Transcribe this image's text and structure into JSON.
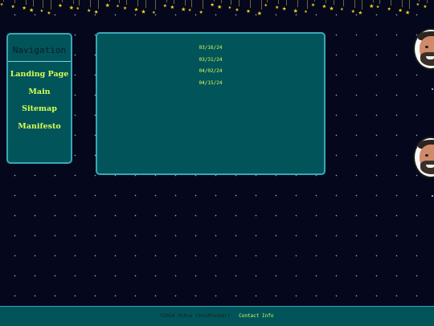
{
  "nav": {
    "title": "Navigation",
    "links": [
      "Landing Page",
      "Main",
      "Sitemap",
      "Manifesto"
    ]
  },
  "main": {
    "dates": [
      "03/16/24",
      "03/31/24",
      "04/02/24",
      "04/15/24"
    ]
  },
  "footer": {
    "copyright": "©2024 Vihna (VoidFucker)",
    "separator": "|",
    "contact": "Contact Info"
  },
  "colors": {
    "background": "#05081c",
    "panel": "#02545b",
    "panel_border": "#3aa7b4",
    "link": "#d7ff4f",
    "star": "#f5d21c"
  },
  "icons": [
    "star-icon",
    "avatar-face"
  ]
}
